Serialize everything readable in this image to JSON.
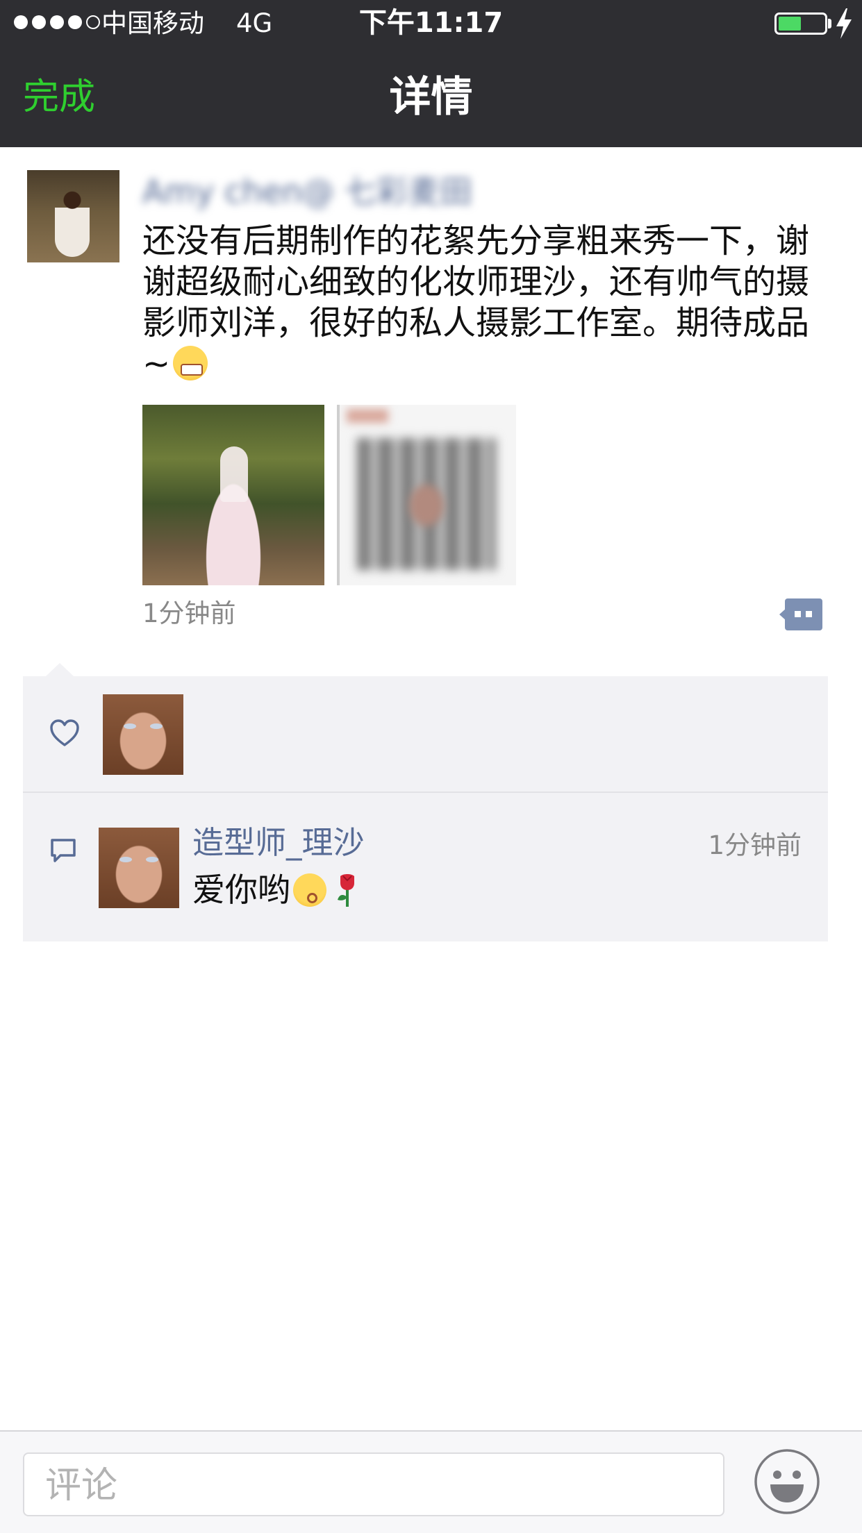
{
  "status_bar": {
    "signal_bars": 4,
    "signal_max": 5,
    "carrier": "中国移动",
    "network": "4G",
    "time": "下午11:17",
    "battery_level": 0.5,
    "charging": true,
    "battery_color": "#4cd964"
  },
  "nav": {
    "done_label": "完成",
    "title": "详情",
    "accent_color": "#2fcf2f",
    "background": "#2e2e32"
  },
  "post": {
    "author": "Amy chen@ 七彩麦田",
    "text": "还没有后期制作的花絮先分享粗来秀一下，谢谢超级耐心细致的化妆师理沙，还有帅气的摄影师刘洋，很好的私人摄影工作室。期待成品~",
    "emoji": "grimacing-face",
    "images": [
      "photo-bride-forest",
      "photo-blurred-qr"
    ],
    "time": "1分钟前",
    "action_icon": "comment-bubble-icon"
  },
  "likes": {
    "icon": "heart-icon",
    "users": [
      "造型师_理沙"
    ]
  },
  "comments": [
    {
      "icon": "comment-icon",
      "name": "造型师_理沙",
      "time": "1分钟前",
      "text": "爱你哟",
      "emojis": [
        "kissing-face",
        "rose"
      ]
    }
  ],
  "input_bar": {
    "placeholder": "评论",
    "emoji_button_icon": "smiley-icon"
  },
  "colors": {
    "link": "#576b95",
    "panel": "#f2f2f5",
    "meta_text": "#888888"
  }
}
